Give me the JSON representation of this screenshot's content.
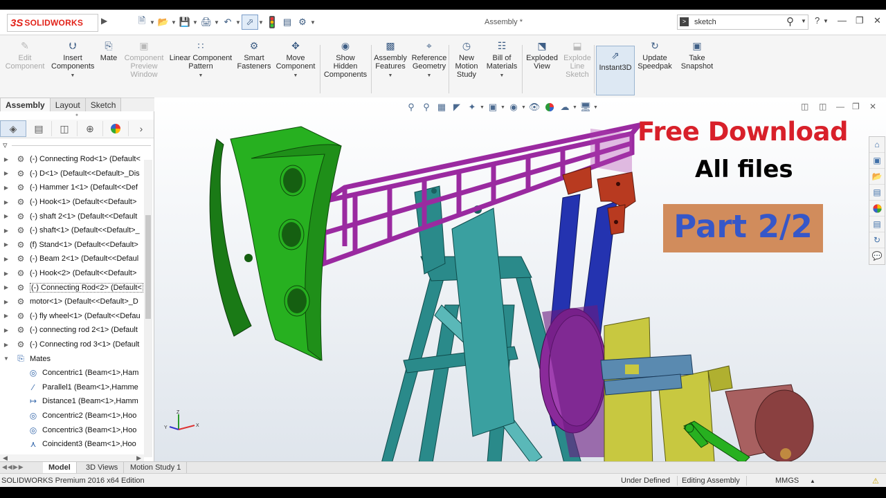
{
  "app": {
    "logo_prefix": "3S",
    "logo_text": "SOLIDWORKS",
    "window_title": "Assembly *",
    "search_value": "sketch",
    "help": "?"
  },
  "toolbar": {
    "items": [
      {
        "label": "Edit\nComponent",
        "icon": "edit-component-icon",
        "enabled": false
      },
      {
        "label": "Insert\nComponents",
        "icon": "insert-components-icon",
        "enabled": true
      },
      {
        "label": "Mate",
        "icon": "mate-icon",
        "enabled": true
      },
      {
        "label": "Component\nPreview\nWindow",
        "icon": "preview-window-icon",
        "enabled": false
      },
      {
        "label": "Linear Component\nPattern",
        "icon": "linear-pattern-icon",
        "enabled": true
      },
      {
        "label": "Smart\nFasteners",
        "icon": "smart-fasteners-icon",
        "enabled": true
      },
      {
        "label": "Move\nComponent",
        "icon": "move-component-icon",
        "enabled": true
      },
      {
        "label": "Show\nHidden\nComponents",
        "icon": "show-hidden-icon",
        "enabled": true
      },
      {
        "label": "Assembly\nFeatures",
        "icon": "assembly-features-icon",
        "enabled": true
      },
      {
        "label": "Reference\nGeometry",
        "icon": "reference-geometry-icon",
        "enabled": true
      },
      {
        "label": "New\nMotion\nStudy",
        "icon": "motion-study-icon",
        "enabled": true
      },
      {
        "label": "Bill of\nMaterials",
        "icon": "bom-icon",
        "enabled": true
      },
      {
        "label": "Exploded\nView",
        "icon": "exploded-view-icon",
        "enabled": true
      },
      {
        "label": "Explode\nLine\nSketch",
        "icon": "explode-line-icon",
        "enabled": false
      },
      {
        "label": "Instant3D",
        "icon": "instant3d-icon",
        "enabled": true,
        "active": true
      },
      {
        "label": "Update\nSpeedpak",
        "icon": "speedpak-icon",
        "enabled": true
      },
      {
        "label": "Take\nSnapshot",
        "icon": "snapshot-icon",
        "enabled": true
      }
    ]
  },
  "cm_tabs": [
    "Assembly",
    "Layout",
    "Sketch"
  ],
  "tree": {
    "components": [
      "(-) Connecting Rod<1> (Default<",
      "(-) D<1> (Default<<Default>_Dis",
      "(-) Hammer 1<1> (Default<<Def",
      "(-) Hook<1> (Default<<Default>",
      "(-) shaft 2<1> (Default<<Default",
      "(-) shaft<1> (Default<<Default>_",
      "(f) Stand<1> (Default<<Default>",
      "(-) Beam 2<1> (Default<<Defaul",
      "(-) Hook<2> (Default<<Default>",
      "(-) Connecting Rod<2> (Default<",
      "motor<1> (Default<<Default>_D",
      "(-) fly wheel<1> (Default<<Defau",
      "(-) connecting rod 2<1> (Default",
      "(-) Connecting rod 3<1> (Default"
    ],
    "mates_label": "Mates",
    "mates": [
      {
        "label": "Concentric1 (Beam<1>,Ham",
        "icon": "concentric-icon"
      },
      {
        "label": "Parallel1 (Beam<1>,Hamme",
        "icon": "parallel-icon"
      },
      {
        "label": "Distance1 (Beam<1>,Hamm",
        "icon": "distance-icon"
      },
      {
        "label": "Concentric2 (Beam<1>,Hoo",
        "icon": "concentric-icon"
      },
      {
        "label": "Concentric3 (Beam<1>,Hoo",
        "icon": "concentric-icon"
      },
      {
        "label": "Coincident3 (Beam<1>,Hoo",
        "icon": "coincident-icon"
      }
    ]
  },
  "overlay": {
    "free": "Free Download",
    "all": "All files",
    "part": "Part 2/2"
  },
  "colors": {
    "free_text": "#d8202a",
    "part_box": "#d18c5c",
    "part_text": "#3657c8",
    "hammer": "#27b020",
    "beam": "#9a2aa0",
    "stand": "#2a8a8a",
    "rods": "#2433b0",
    "hook": "#b83a20",
    "motor_base": "#c8c840",
    "motor": "#a86060"
  },
  "bottom_tabs": [
    "Model",
    "3D Views",
    "Motion Study 1"
  ],
  "status": {
    "edition": "SOLIDWORKS Premium 2016 x64 Edition",
    "state": "Under Defined",
    "mode": "Editing Assembly",
    "units": "MMGS"
  }
}
